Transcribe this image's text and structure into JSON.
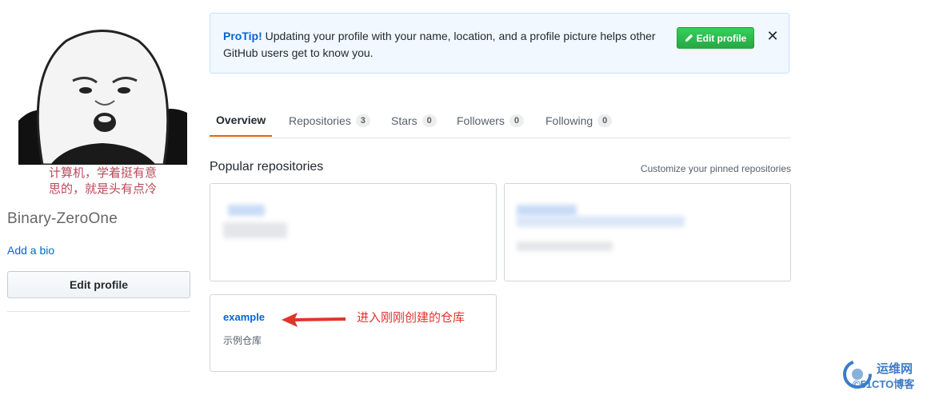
{
  "sidebar": {
    "avatar_caption_line1": "计算机，学着挺有意",
    "avatar_caption_line2": "思的，就是头有点冷",
    "username": "Binary-ZeroOne",
    "add_bio": "Add a bio",
    "edit_profile": "Edit profile"
  },
  "protip": {
    "label": "ProTip!",
    "message": " Updating your profile with your name, location, and a profile picture helps other GitHub users get to know you.",
    "button": "Edit profile",
    "close": "✕"
  },
  "tabs": [
    {
      "label": "Overview",
      "count": null
    },
    {
      "label": "Repositories",
      "count": "3"
    },
    {
      "label": "Stars",
      "count": "0"
    },
    {
      "label": "Followers",
      "count": "0"
    },
    {
      "label": "Following",
      "count": "0"
    }
  ],
  "popular": {
    "title": "Popular repositories",
    "customize": "Customize your pinned repositories",
    "repos": [
      {
        "name": "",
        "description": ""
      },
      {
        "name": "",
        "description": ""
      },
      {
        "name": "example",
        "description": "示例仓库"
      }
    ]
  },
  "annotation": {
    "text": "进入刚刚创建的仓库",
    "color": "#e0352b"
  },
  "watermark": {
    "line1": "运维网",
    "line2": "©51CTO博客"
  },
  "colors": {
    "link": "#0366d6",
    "selected_tab_underline": "#e36209",
    "protip_bg": "#f1f8ff",
    "green_button": "#28a745"
  }
}
